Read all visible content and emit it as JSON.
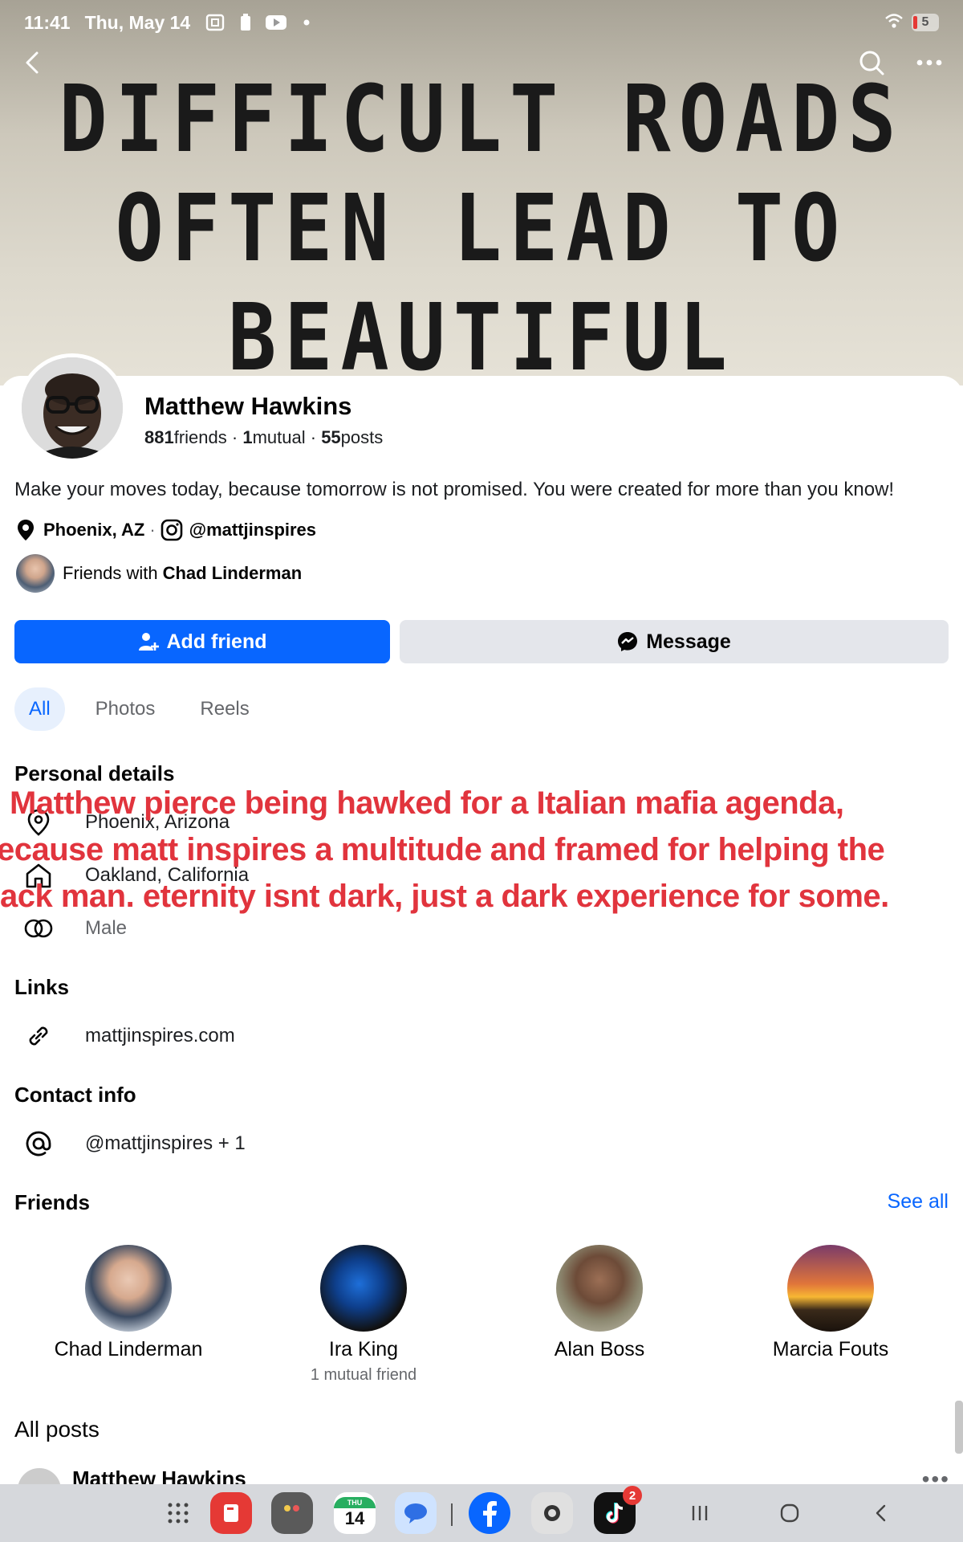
{
  "status": {
    "time": "11:41",
    "date": "Thu, May 14",
    "battery": "5"
  },
  "cover": {
    "line1": "DIFFICULT ROADS",
    "line2": "OFTEN LEAD TO",
    "line3": "BEAUTIFUL"
  },
  "profile": {
    "name": "Matthew Hawkins",
    "friends_count": "881",
    "friends_label": "friends",
    "mutual_count": "1",
    "mutual_label": "mutual",
    "posts_count": "55",
    "posts_label": "posts",
    "bio": "Make your moves today, because tomorrow is not promised. You were created for more than you know!",
    "location": "Phoenix, AZ",
    "instagram": "@mattjinspires",
    "friends_with_prefix": "Friends with",
    "friends_with_name": "Chad Linderman"
  },
  "actions": {
    "add_friend": "Add friend",
    "message": "Message"
  },
  "tabs": [
    {
      "label": "All",
      "active": true
    },
    {
      "label": "Photos",
      "active": false
    },
    {
      "label": "Reels",
      "active": false
    }
  ],
  "personal_details": {
    "heading": "Personal details",
    "current_city": "Phoenix, Arizona",
    "hometown": "Oakland, California",
    "gender": "Male"
  },
  "overlay_caption": {
    "line1": "Matthew pierce being hawked for a Italian mafia agenda,",
    "line2": "ecause matt inspires a multitude and framed for helping the",
    "line3": "ack man. eternity isnt dark, just a dark experience for some.",
    "color": "#e1343d"
  },
  "links": {
    "heading": "Links",
    "website": "mattjinspires.com"
  },
  "contact": {
    "heading": "Contact info",
    "handle": "@mattjinspires + 1"
  },
  "friends": {
    "heading": "Friends",
    "see_all": "See all",
    "list": [
      {
        "name": "Chad Linderman",
        "mutual": ""
      },
      {
        "name": "Ira King",
        "mutual": "1 mutual friend"
      },
      {
        "name": "Alan Boss",
        "mutual": ""
      },
      {
        "name": "Marcia Fouts",
        "mutual": ""
      }
    ]
  },
  "posts": {
    "heading": "All posts",
    "first_author": "Matthew Hawkins",
    "more": "•••"
  },
  "dock": {
    "calendar_day": "14",
    "calendar_dow": "THU",
    "tiktok_badge": "2"
  },
  "colors": {
    "primary": "#0866ff",
    "secondary_button": "#e4e6eb",
    "active_tab_bg": "#e7f0fd",
    "muted_text": "#65676b"
  }
}
